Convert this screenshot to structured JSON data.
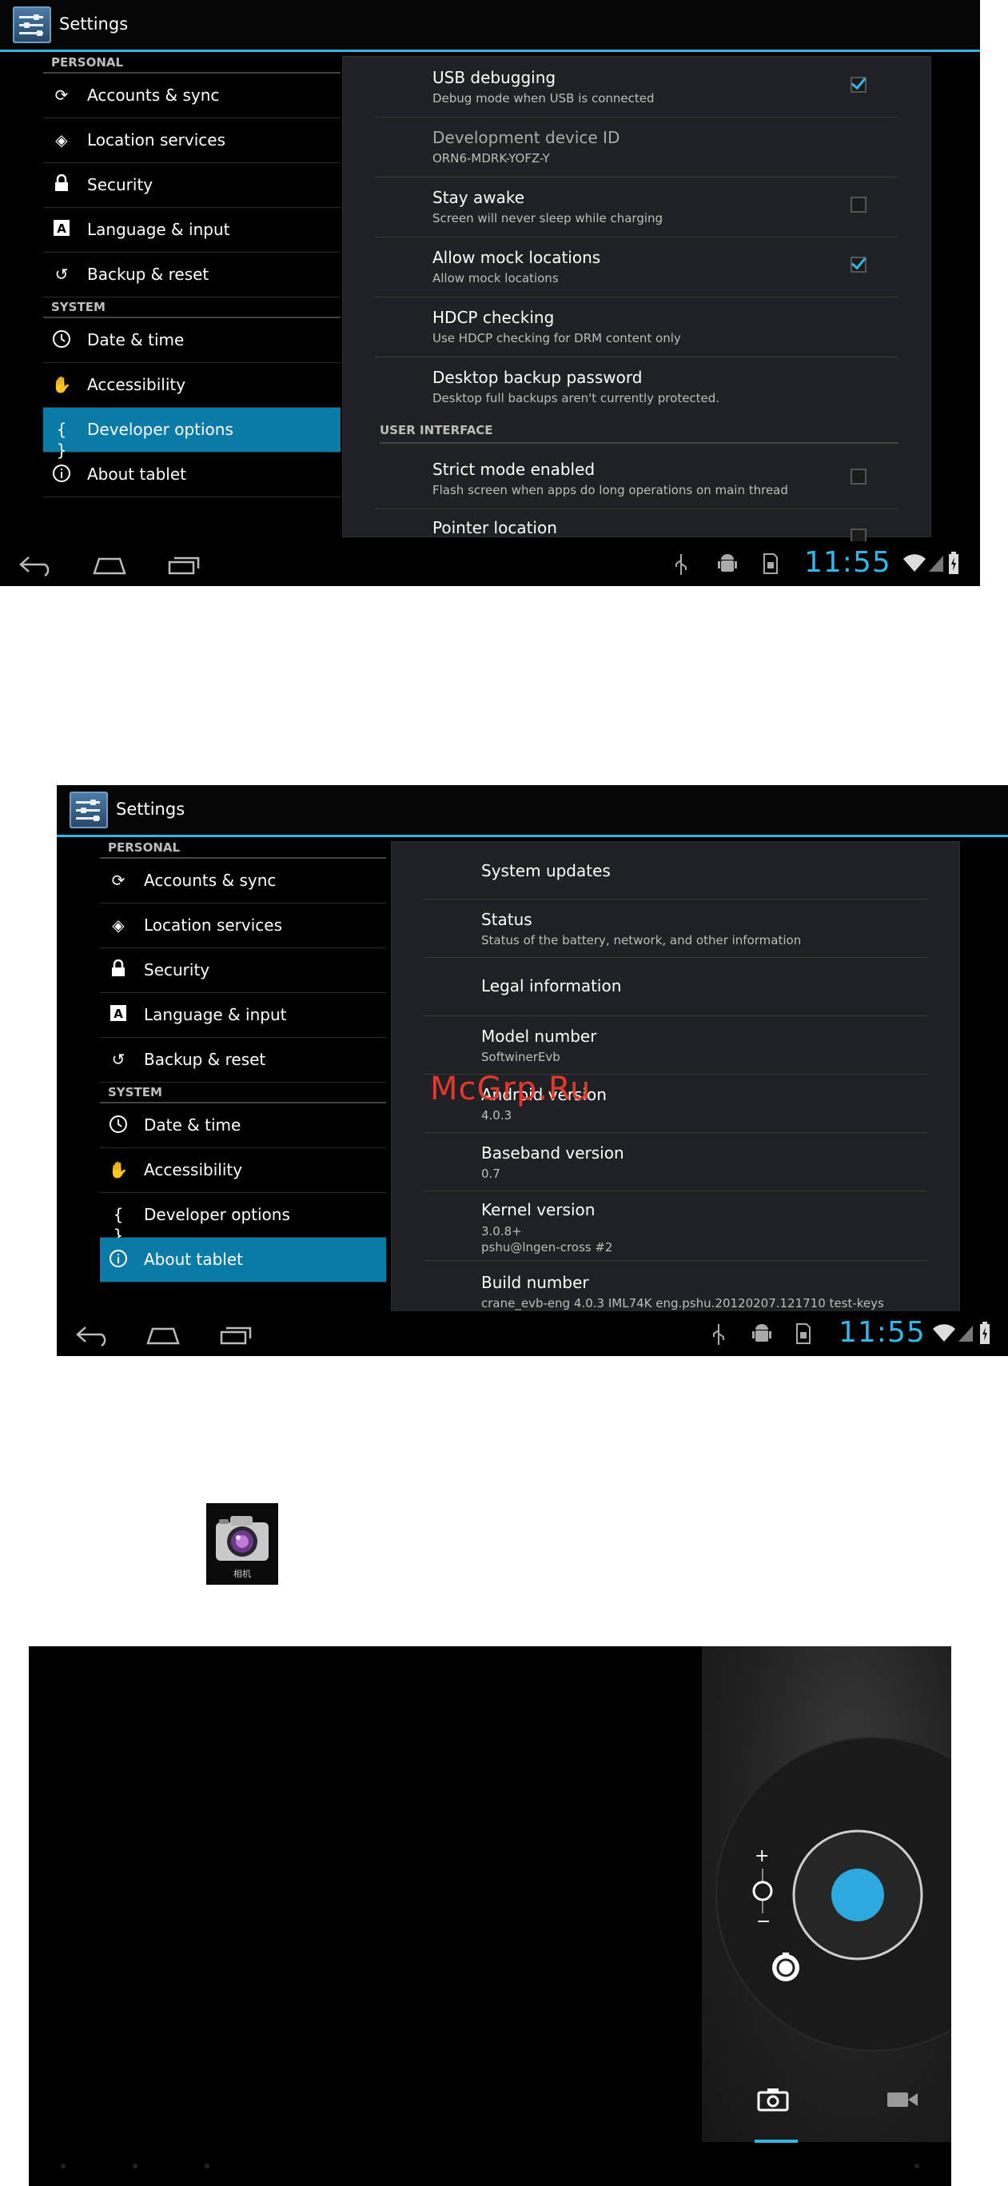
{
  "screen1": {
    "title": "Settings",
    "sidebar": {
      "personal_header": "PERSONAL",
      "system_header": "SYSTEM",
      "personal_items": [
        {
          "label": "Accounts & sync",
          "icon": "sync-icon"
        },
        {
          "label": "Location services",
          "icon": "location-icon"
        },
        {
          "label": "Security",
          "icon": "lock-icon"
        },
        {
          "label": "Language & input",
          "icon": "keyboard-icon"
        },
        {
          "label": "Backup & reset",
          "icon": "backup-icon"
        }
      ],
      "system_items": [
        {
          "label": "Date & time",
          "icon": "clock-icon"
        },
        {
          "label": "Accessibility",
          "icon": "hand-icon"
        },
        {
          "label": "Developer options",
          "icon": "braces-icon"
        },
        {
          "label": "About tablet",
          "icon": "info-icon"
        }
      ],
      "active": "Developer options"
    },
    "prefs": [
      {
        "title": "USB debugging",
        "summary": "Debug mode when USB is connected",
        "checked": true
      },
      {
        "title": "Development device ID",
        "summary": "ORN6-MDRK-YOFZ-Y",
        "dimmed": true
      },
      {
        "title": "Stay awake",
        "summary": "Screen will never sleep while charging",
        "checked": false
      },
      {
        "title": "Allow mock locations",
        "summary": "Allow mock locations",
        "checked": true
      },
      {
        "title": "HDCP checking",
        "summary": "Use HDCP checking for DRM content only"
      },
      {
        "title": "Desktop backup password",
        "summary": "Desktop full backups aren't currently protected."
      }
    ],
    "ui_header": "USER INTERFACE",
    "ui_prefs": [
      {
        "title": "Strict mode enabled",
        "summary": "Flash screen when apps do long operations on main thread",
        "checked": false
      },
      {
        "title": "Pointer location",
        "summary": "",
        "checked": false
      }
    ],
    "clock": "11:55"
  },
  "screen2": {
    "title": "Settings",
    "sidebar": {
      "personal_header": "PERSONAL",
      "system_header": "SYSTEM",
      "personal_items": [
        {
          "label": "Accounts & sync",
          "icon": "sync-icon"
        },
        {
          "label": "Location services",
          "icon": "location-icon"
        },
        {
          "label": "Security",
          "icon": "lock-icon"
        },
        {
          "label": "Language & input",
          "icon": "keyboard-icon"
        },
        {
          "label": "Backup & reset",
          "icon": "backup-icon"
        }
      ],
      "system_items": [
        {
          "label": "Date & time",
          "icon": "clock-icon"
        },
        {
          "label": "Accessibility",
          "icon": "hand-icon"
        },
        {
          "label": "Developer options",
          "icon": "braces-icon"
        },
        {
          "label": "About tablet",
          "icon": "info-icon"
        }
      ],
      "active": "About tablet"
    },
    "about": [
      {
        "title": "System updates",
        "lines": []
      },
      {
        "title": "Status",
        "lines": [
          "Status of the battery, network, and other information"
        ]
      },
      {
        "title": "Legal information",
        "lines": []
      },
      {
        "title": "Model number",
        "lines": [
          "SoftwinerEvb"
        ]
      },
      {
        "title": "Android version",
        "lines": [
          "4.0.3"
        ]
      },
      {
        "title": "Baseband version",
        "lines": [
          "0.7"
        ]
      },
      {
        "title": "Kernel version",
        "lines": [
          "3.0.8+",
          "pshu@lngen-cross #2"
        ]
      },
      {
        "title": "Build number",
        "lines": [
          "crane_evb-eng 4.0.3 IML74K eng.pshu.20120207.121710 test-keys"
        ]
      }
    ],
    "clock": "11:55",
    "watermark": "McGrp.Ru"
  },
  "camera_icon": {
    "caption": "相机"
  },
  "camera": {
    "zoom_plus": "+",
    "zoom_minus": "−",
    "colors": {
      "accent": "#33b5e5",
      "shutter": "#2ea9e0"
    }
  }
}
